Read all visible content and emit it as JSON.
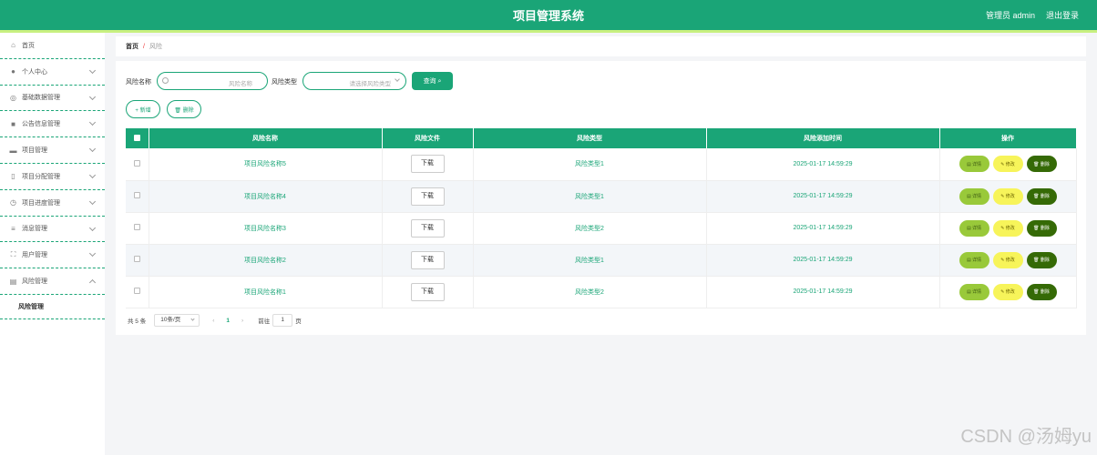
{
  "header": {
    "title": "项目管理系统",
    "admin": "管理员 admin",
    "logout": "退出登录"
  },
  "sidebar": {
    "items": [
      {
        "label": "首页",
        "icon": "home-icon",
        "glyph": "⌂",
        "chevron": ""
      },
      {
        "label": "个人中心",
        "icon": "user-icon",
        "glyph": "●",
        "chevron": "down"
      },
      {
        "label": "基础数据管理",
        "icon": "settings-icon",
        "glyph": "◎",
        "chevron": "down"
      },
      {
        "label": "公告信息管理",
        "icon": "notice-icon",
        "glyph": "■",
        "chevron": "down"
      },
      {
        "label": "项目管理",
        "icon": "briefcase-icon",
        "glyph": "▬",
        "chevron": "down"
      },
      {
        "label": "项目分配管理",
        "icon": "lock-icon",
        "glyph": "▯",
        "chevron": "down"
      },
      {
        "label": "项目进度管理",
        "icon": "clock-icon",
        "glyph": "◷",
        "chevron": "down"
      },
      {
        "label": "消息管理",
        "icon": "menu-icon",
        "glyph": "≡",
        "chevron": "down"
      },
      {
        "label": "用户管理",
        "icon": "expand-icon",
        "glyph": "⛶",
        "chevron": "down"
      },
      {
        "label": "风险管理",
        "icon": "clipboard-icon",
        "glyph": "▤",
        "chevron": "up"
      }
    ],
    "sub_item": "风险管理"
  },
  "breadcrumb": {
    "home": "首页",
    "sep": "/",
    "current": "风险"
  },
  "search": {
    "name_label": "风险名称",
    "name_placeholder": "风险名称",
    "type_label": "风险类型",
    "type_placeholder": "请选择风险类型",
    "query_btn": "查询 ⌕"
  },
  "actions": {
    "add": "+ 新增",
    "delete": "🗑 删除"
  },
  "table": {
    "headers": [
      "风险名称",
      "风险文件",
      "风险类型",
      "风险添加时间",
      "操作"
    ],
    "download_label": "下载",
    "op_detail": "▤ 详情",
    "op_edit": "✎ 修改",
    "op_delete": "🗑 删除",
    "rows": [
      {
        "name": "项目风险名称5",
        "type": "风险类型1",
        "time": "2025-01-17 14:59:29"
      },
      {
        "name": "项目风险名称4",
        "type": "风险类型1",
        "time": "2025-01-17 14:59:29"
      },
      {
        "name": "项目风险名称3",
        "type": "风险类型2",
        "time": "2025-01-17 14:59:29"
      },
      {
        "name": "项目风险名称2",
        "type": "风险类型1",
        "time": "2025-01-17 14:59:29"
      },
      {
        "name": "项目风险名称1",
        "type": "风险类型2",
        "time": "2025-01-17 14:59:29"
      }
    ]
  },
  "pagination": {
    "total": "共 5 条",
    "page_size": "10条/页",
    "prev": "‹",
    "current_page": "1",
    "next": "›",
    "goto_label": "前往",
    "goto_value": "1",
    "page_suffix": "页"
  },
  "watermark": "CSDN @汤姆yu",
  "colors": {
    "primary": "#1aa577",
    "accent_bar": "#c8f080",
    "detail": "#99c93a",
    "edit": "#f7f45a",
    "delete": "#356a06"
  }
}
